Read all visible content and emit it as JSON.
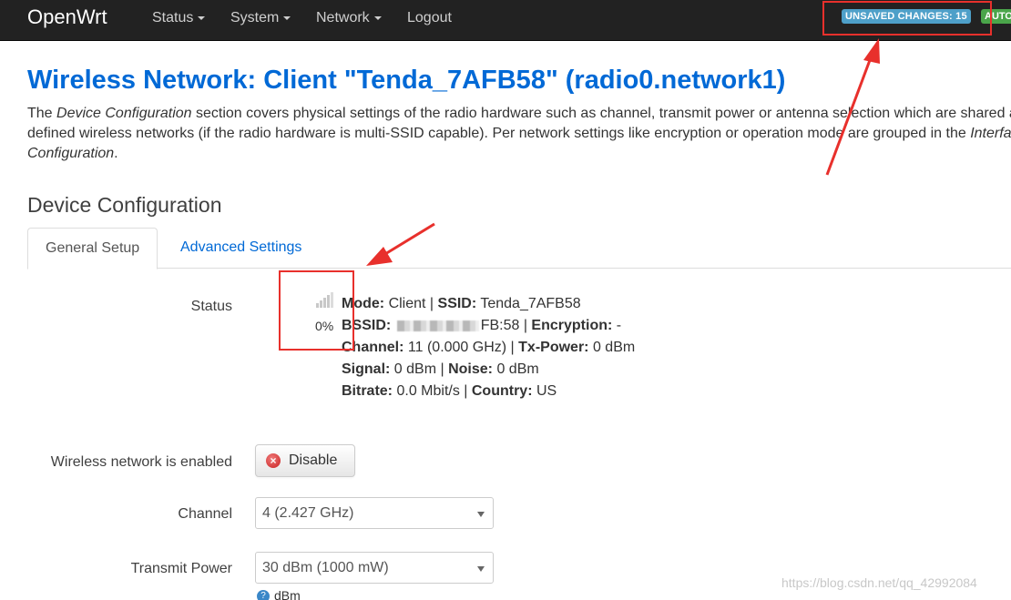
{
  "navbar": {
    "brand": "OpenWrt",
    "menu": [
      {
        "label": "Status"
      },
      {
        "label": "System"
      },
      {
        "label": "Network"
      },
      {
        "label": "Logout"
      }
    ],
    "unsaved_badge": "UNSAVED CHANGES: 15",
    "auto_badge": "AUTO"
  },
  "page": {
    "title": "Wireless Network: Client \"Tenda_7AFB58\" (radio0.network1)",
    "intro": {
      "p1": "The ",
      "p1_em": "Device Configuration",
      "p1_rest": " section covers physical settings of the radio hardware such as channel, transmit power or antenna selection which are shared among all",
      "p2_a": "defined wireless networks (if the radio hardware is multi-SSID capable). Per network settings like encryption or operation mode are grouped in the ",
      "p2_em": "Interface",
      "p3_em": "Configuration",
      "p3_rest": "."
    }
  },
  "device_config": {
    "title": "Device Configuration",
    "tabs": [
      {
        "label": "General Setup",
        "active": true
      },
      {
        "label": "Advanced Settings",
        "active": false
      }
    ],
    "status": {
      "label": "Status",
      "signal_percent": "0%",
      "mode_label": "Mode:",
      "mode_value": "Client",
      "ssid_label": "SSID:",
      "ssid_value": "Tenda_7AFB58",
      "bssid_label": "BSSID:",
      "bssid_visible_suffix": "FB:58",
      "encryption_label": "Encryption:",
      "encryption_value": "-",
      "channel_label": "Channel:",
      "channel_value": "11 (0.000 GHz)",
      "txpower_label": "Tx-Power:",
      "txpower_value": "0 dBm",
      "signal_label": "Signal:",
      "signal_value": "0 dBm",
      "noise_label": "Noise:",
      "noise_value": "0 dBm",
      "bitrate_label": "Bitrate:",
      "bitrate_value": "0.0 Mbit/s",
      "country_label": "Country:",
      "country_value": "US"
    },
    "enabled": {
      "label": "Wireless network is enabled",
      "button": "Disable"
    },
    "channel": {
      "label": "Channel",
      "value": "4 (2.427 GHz)"
    },
    "transmit_power": {
      "label": "Transmit Power",
      "value": "30 dBm (1000 mW)",
      "unit": "dBm"
    }
  },
  "watermark": "https://blog.csdn.net/qq_42992084",
  "colors": {
    "annotation": "#e8302c",
    "link": "#0069d6",
    "navbar": "#222222"
  }
}
